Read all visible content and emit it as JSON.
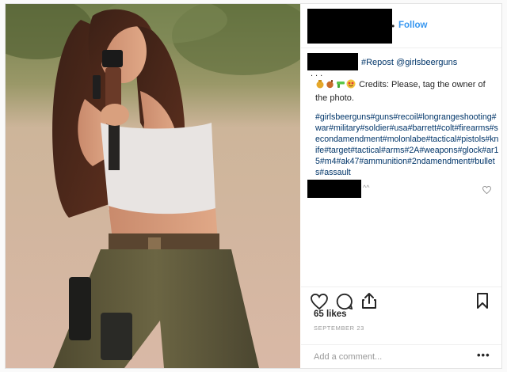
{
  "header": {
    "follow_dot": "•",
    "follow_label": "Follow"
  },
  "caption": {
    "repost": "#Repost @girlsbeerguns",
    "ellipsis": "...",
    "emojis": [
      "money-bag-emoji",
      "bomb-emoji",
      "water-pistol-emoji",
      "heart-eyes-emoji"
    ],
    "credits": "Credits: Please, tag the owner of the photo.",
    "hashtags": "#girlsbeerguns#guns#recoil#longrangeshooting#war#military#soldier#usa#barrett#colt#firearms#secondamendment#molonlabe#tactical#pistols#knife#target#tactical#arms#2A#weapons#glock#ar15#m4#ak47#ammunition#2ndamendment#bullets#assault",
    "reply_caret": "^^"
  },
  "actions": {
    "icons": [
      "heart-icon",
      "comment-icon",
      "share-icon",
      "bookmark-icon"
    ],
    "likes": "65 likes",
    "date": "SEPTEMBER 23",
    "add_comment_placeholder": "Add a comment...",
    "more": "•••"
  },
  "colors": {
    "link": "#003569",
    "follow": "#3897f0",
    "muted": "#999999",
    "redaction": "#000000"
  }
}
